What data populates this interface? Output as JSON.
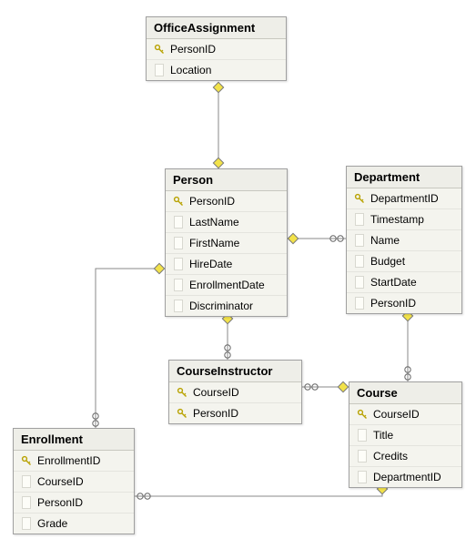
{
  "entities": {
    "officeAssignment": {
      "title": "OfficeAssignment",
      "columns": [
        {
          "name": "PersonID",
          "pk": true
        },
        {
          "name": "Location",
          "pk": false
        }
      ]
    },
    "person": {
      "title": "Person",
      "columns": [
        {
          "name": "PersonID",
          "pk": true
        },
        {
          "name": "LastName",
          "pk": false
        },
        {
          "name": "FirstName",
          "pk": false
        },
        {
          "name": "HireDate",
          "pk": false
        },
        {
          "name": "EnrollmentDate",
          "pk": false
        },
        {
          "name": "Discriminator",
          "pk": false
        }
      ]
    },
    "department": {
      "title": "Department",
      "columns": [
        {
          "name": "DepartmentID",
          "pk": true
        },
        {
          "name": "Timestamp",
          "pk": false
        },
        {
          "name": "Name",
          "pk": false
        },
        {
          "name": "Budget",
          "pk": false
        },
        {
          "name": "StartDate",
          "pk": false
        },
        {
          "name": "PersonID",
          "pk": false
        }
      ]
    },
    "courseInstructor": {
      "title": "CourseInstructor",
      "columns": [
        {
          "name": "CourseID",
          "pk": true
        },
        {
          "name": "PersonID",
          "pk": true
        }
      ]
    },
    "course": {
      "title": "Course",
      "columns": [
        {
          "name": "CourseID",
          "pk": true
        },
        {
          "name": "Title",
          "pk": false
        },
        {
          "name": "Credits",
          "pk": false
        },
        {
          "name": "DepartmentID",
          "pk": false
        }
      ]
    },
    "enrollment": {
      "title": "Enrollment",
      "columns": [
        {
          "name": "EnrollmentID",
          "pk": true
        },
        {
          "name": "CourseID",
          "pk": false
        },
        {
          "name": "PersonID",
          "pk": false
        },
        {
          "name": "Grade",
          "pk": false
        }
      ]
    }
  },
  "relationships": [
    {
      "from": "OfficeAssignment",
      "to": "Person",
      "type": "one-to-one"
    },
    {
      "from": "Person",
      "to": "Department",
      "type": "one-to-many"
    },
    {
      "from": "Person",
      "to": "CourseInstructor",
      "type": "one-to-many"
    },
    {
      "from": "CourseInstructor",
      "to": "Course",
      "type": "many-to-one"
    },
    {
      "from": "Department",
      "to": "Course",
      "type": "one-to-many"
    },
    {
      "from": "Person",
      "to": "Enrollment",
      "type": "one-to-many"
    },
    {
      "from": "Course",
      "to": "Enrollment",
      "type": "one-to-many"
    }
  ]
}
